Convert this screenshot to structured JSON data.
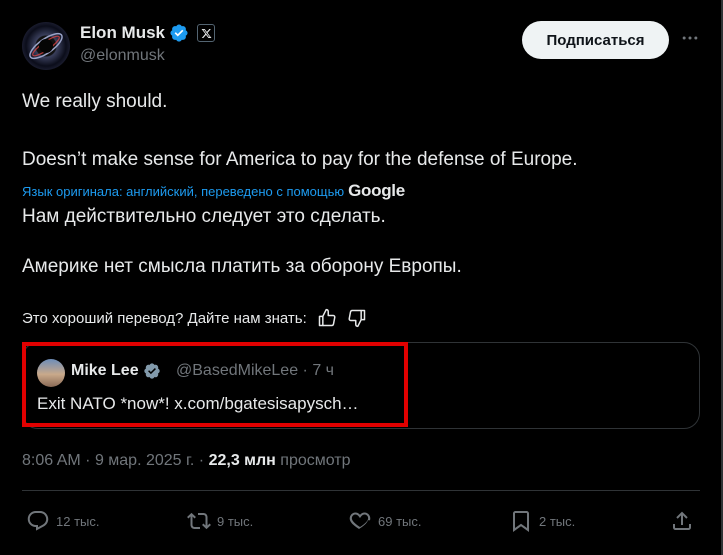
{
  "author": {
    "display_name": "Elon Musk",
    "handle": "@elonmusk",
    "verified_icon": "verified-badge-icon",
    "affiliation_icon": "x-logo-icon"
  },
  "header": {
    "subscribe_label": "Подписаться",
    "more_icon": "more-horizontal-icon"
  },
  "tweet": {
    "line1": "We really should.",
    "line2": "Doesn’t make sense for America to pay for the defense of Europe.",
    "translation_note": "Язык оригинала: английский, переведено с помощью",
    "translation_provider": "Google",
    "translated_line1": "Нам действительно следует это сделать.",
    "translated_line2": "Америке нет смысла платить за оборону Европы.",
    "feedback_prompt": "Это хороший перевод? Дайте нам знать:"
  },
  "quote": {
    "display_name": "Mike Lee",
    "handle": "@BasedMikeLee",
    "separator": "·",
    "time": "7 ч",
    "text": "Exit NATO *now*! x.com/bgatesisapysch…"
  },
  "meta": {
    "time": "8:06 AM",
    "sep1": "·",
    "date": "9 мар. 2025 г.",
    "sep2": "·",
    "views_count": "22,3 млн",
    "views_label": "просмотр"
  },
  "actions": {
    "replies": "12 тыс.",
    "reposts": "9 тыс.",
    "likes": "69 тыс.",
    "bookmarks": "2 тыс."
  },
  "colors": {
    "background": "#000000",
    "text": "#e7e9ea",
    "muted": "#71767b",
    "accent": "#1d9bf0",
    "highlight_box": "#e10000"
  }
}
